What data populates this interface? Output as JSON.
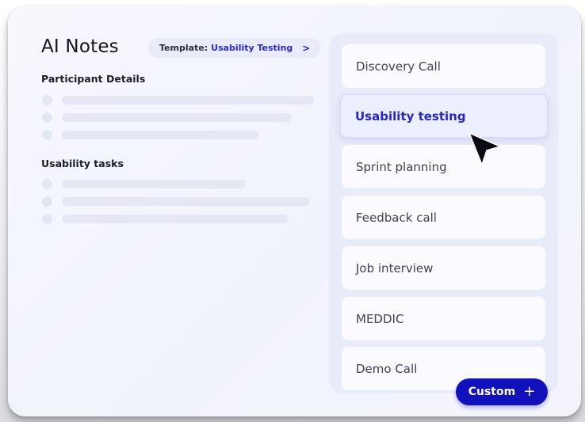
{
  "header": {
    "title": "AI Notes",
    "template_prefix": "Template:",
    "template_value": "Usability Testing",
    "template_chevron": ">"
  },
  "sections": [
    {
      "label": "Participant Details"
    },
    {
      "label": "Usability tasks"
    }
  ],
  "template_options": [
    {
      "label": "Discovery Call"
    },
    {
      "label": "Usability testing",
      "selected": true
    },
    {
      "label": "Sprint planning"
    },
    {
      "label": "Feedback call"
    },
    {
      "label": "Job interview"
    },
    {
      "label": "MEDDIC"
    },
    {
      "label": "Demo Call"
    }
  ],
  "custom_button": {
    "label": "Custom",
    "icon": "plus-icon",
    "icon_glyph": "+"
  },
  "colors": {
    "accent": "#1111bb",
    "selected_text": "#2626c6",
    "panel_bg": "#e8ebf9"
  }
}
